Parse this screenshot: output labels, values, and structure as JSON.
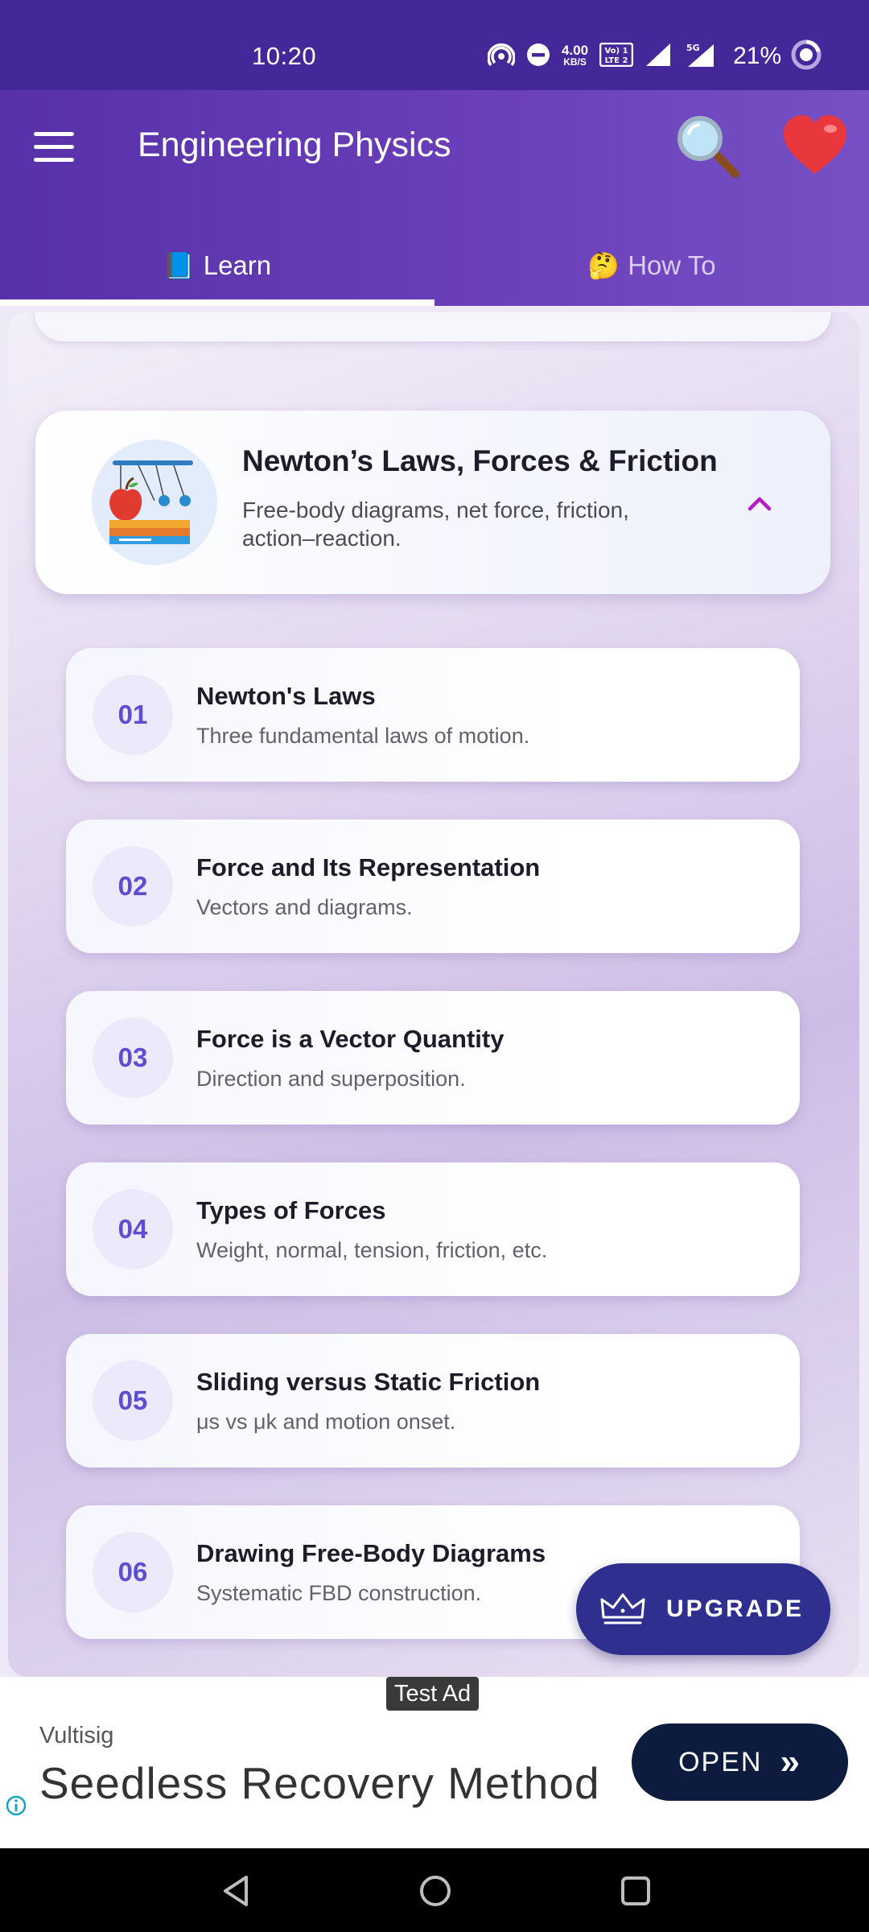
{
  "status_bar": {
    "time": "10:20",
    "net_speed": "4.00",
    "net_unit": "KB/S",
    "volte": "Vo) LTE 2",
    "signal_label": "5G",
    "battery": "21%"
  },
  "app_bar": {
    "title": "Engineering Physics",
    "menu_icon": "hamburger-menu-icon",
    "search_icon": "magnifying-glass-icon",
    "favorite_icon": "heart-icon"
  },
  "tabs": [
    {
      "label": "Learn",
      "emoji": "📘",
      "active": true
    },
    {
      "label": "How To",
      "emoji": "🤔",
      "active": false
    }
  ],
  "section": {
    "title": "Newton’s Laws, Forces & Friction",
    "subtitle": "Free-body diagrams, net force, friction, action–reaction.",
    "expanded": true
  },
  "lessons": [
    {
      "number": "01",
      "title": "Newton's Laws",
      "subtitle": "Three fundamental laws of motion."
    },
    {
      "number": "02",
      "title": "Force and Its Representation",
      "subtitle": "Vectors and diagrams."
    },
    {
      "number": "03",
      "title": "Force is a Vector Quantity",
      "subtitle": "Direction and superposition."
    },
    {
      "number": "04",
      "title": "Types of Forces",
      "subtitle": "Weight, normal, tension, friction, etc."
    },
    {
      "number": "05",
      "title": "Sliding versus Static Friction",
      "subtitle": "μs vs μk and motion onset."
    },
    {
      "number": "06",
      "title": "Drawing Free-Body Diagrams",
      "subtitle": "Systematic FBD construction."
    }
  ],
  "upgrade_button": {
    "label": "UPGRADE"
  },
  "ad": {
    "badge": "Test Ad",
    "brand": "Vultisig",
    "headline": "Seedless Recovery Method",
    "cta": "OPEN",
    "cta_arrow": "»"
  },
  "colors": {
    "status_bar": "#44289a",
    "app_bar": "#5731a9",
    "accent_number": "#5d4ed1",
    "chevron": "#b41fc4",
    "upgrade_bg": "#2f2f8f",
    "ad_cta_bg": "#0c1b3e"
  }
}
